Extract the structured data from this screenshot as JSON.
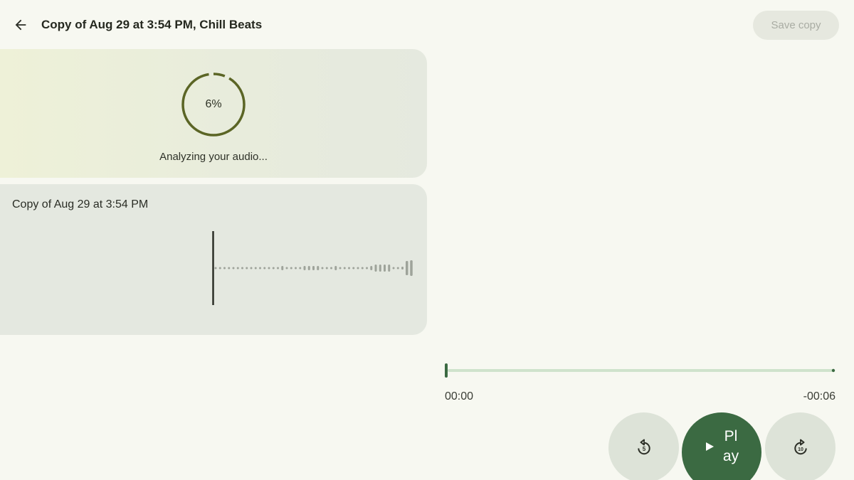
{
  "header": {
    "title": "Copy of Aug 29 at 3:54 PM, Chill Beats",
    "save_label": "Save copy"
  },
  "analysis": {
    "progress_percent": 6,
    "progress_label": "6%",
    "status": "Analyzing your audio..."
  },
  "clip": {
    "name": "Copy of Aug 29 at 3:54 PM"
  },
  "player": {
    "elapsed": "00:00",
    "remaining": "-00:06",
    "progress_fraction": 0.0,
    "play_label": "Play",
    "rewind_seconds": "5",
    "forward_seconds": "10"
  },
  "colors": {
    "accent": "#3b6a42",
    "ring": "#5b6525",
    "wave": "#9ea39a",
    "track": "#cfe3cc"
  },
  "icons": {
    "back": "arrow-left-icon",
    "rewind": "replay-5-icon",
    "forward": "forward-10-icon",
    "play": "play-icon"
  }
}
